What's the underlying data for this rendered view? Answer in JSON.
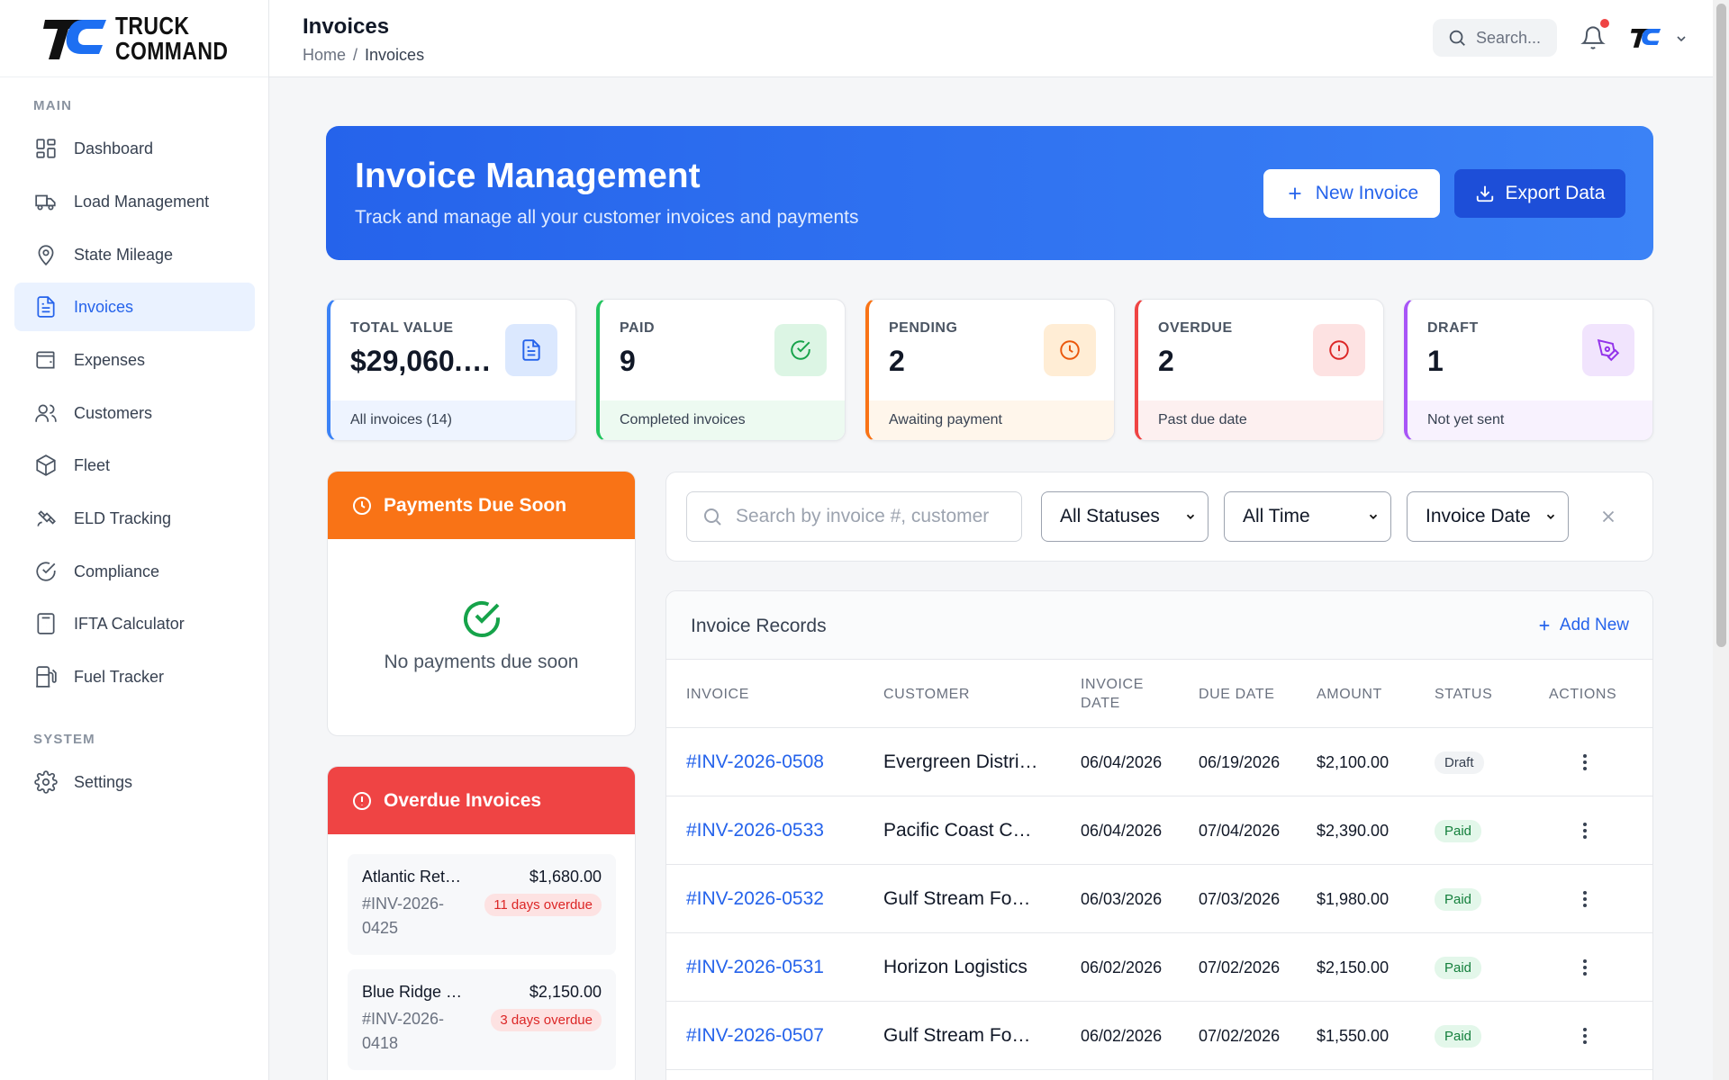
{
  "brand": {
    "line1": "TRUCK",
    "line2": "COMMAND"
  },
  "sidebar": {
    "main_label": "MAIN",
    "system_label": "SYSTEM",
    "items": [
      {
        "label": "Dashboard",
        "icon": "dashboard-icon"
      },
      {
        "label": "Load Management",
        "icon": "truck-icon"
      },
      {
        "label": "State Mileage",
        "icon": "map-pin-icon"
      },
      {
        "label": "Invoices",
        "icon": "file-text-icon",
        "active": true
      },
      {
        "label": "Expenses",
        "icon": "wallet-icon"
      },
      {
        "label": "Customers",
        "icon": "users-icon"
      },
      {
        "label": "Fleet",
        "icon": "package-icon"
      },
      {
        "label": "ELD Tracking",
        "icon": "satellite-icon"
      },
      {
        "label": "Compliance",
        "icon": "check-circle-icon"
      },
      {
        "label": "IFTA Calculator",
        "icon": "calculator-icon"
      },
      {
        "label": "Fuel Tracker",
        "icon": "fuel-icon"
      }
    ],
    "settings": {
      "label": "Settings",
      "icon": "gear-icon"
    }
  },
  "header": {
    "title": "Invoices",
    "breadcrumb": {
      "home": "Home",
      "sep": "/",
      "current": "Invoices"
    },
    "search_placeholder": "Search..."
  },
  "banner": {
    "title": "Invoice Management",
    "subtitle": "Track and manage all your customer invoices and payments",
    "new_invoice": "New Invoice",
    "export": "Export Data"
  },
  "stats": [
    {
      "label": "TOTAL VALUE",
      "value": "$29,060.…",
      "footer": "All invoices (14)",
      "color": "#3b82f6"
    },
    {
      "label": "PAID",
      "value": "9",
      "footer": "Completed invoices",
      "color": "#22c55e"
    },
    {
      "label": "PENDING",
      "value": "2",
      "footer": "Awaiting payment",
      "color": "#f97316"
    },
    {
      "label": "OVERDUE",
      "value": "2",
      "footer": "Past due date",
      "color": "#ef4444"
    },
    {
      "label": "DRAFT",
      "value": "1",
      "footer": "Not yet sent",
      "color": "#a855f7"
    }
  ],
  "due_soon": {
    "title": "Payments Due Soon",
    "empty": "No payments due soon"
  },
  "overdue": {
    "title": "Overdue Invoices",
    "items": [
      {
        "name": "Atlantic Ret…",
        "amount": "$1,680.00",
        "number": "#INV-2026-0425",
        "badge": "11 days overdue"
      },
      {
        "name": "Blue Ridge …",
        "amount": "$2,150.00",
        "number": "#INV-2026-0418",
        "badge": "3 days overdue"
      }
    ]
  },
  "filters": {
    "search_placeholder": "Search by invoice #, customer",
    "status": "All Statuses",
    "time": "All Time",
    "sort": "Invoice Date"
  },
  "table": {
    "title": "Invoice Records",
    "add_new": "Add New",
    "columns": {
      "invoice": "INVOICE",
      "customer": "CUSTOMER",
      "invoice_date": "INVOICE DATE",
      "due_date": "DUE DATE",
      "amount": "AMOUNT",
      "status": "STATUS",
      "actions": "ACTIONS"
    },
    "rows": [
      {
        "invoice": "#INV-2026-0508",
        "customer": "Evergreen Distri…",
        "invoice_date": "06/04/2026",
        "due_date": "06/19/2026",
        "amount": "$2,100.00",
        "status": "Draft"
      },
      {
        "invoice": "#INV-2026-0533",
        "customer": "Pacific Coast C…",
        "invoice_date": "06/04/2026",
        "due_date": "07/04/2026",
        "amount": "$2,390.00",
        "status": "Paid"
      },
      {
        "invoice": "#INV-2026-0532",
        "customer": "Gulf Stream Fo…",
        "invoice_date": "06/03/2026",
        "due_date": "07/03/2026",
        "amount": "$1,980.00",
        "status": "Paid"
      },
      {
        "invoice": "#INV-2026-0531",
        "customer": "Horizon Logistics",
        "invoice_date": "06/02/2026",
        "due_date": "07/02/2026",
        "amount": "$2,150.00",
        "status": "Paid"
      },
      {
        "invoice": "#INV-2026-0507",
        "customer": "Gulf Stream Fo…",
        "invoice_date": "06/02/2026",
        "due_date": "07/02/2026",
        "amount": "$1,550.00",
        "status": "Paid"
      }
    ]
  }
}
